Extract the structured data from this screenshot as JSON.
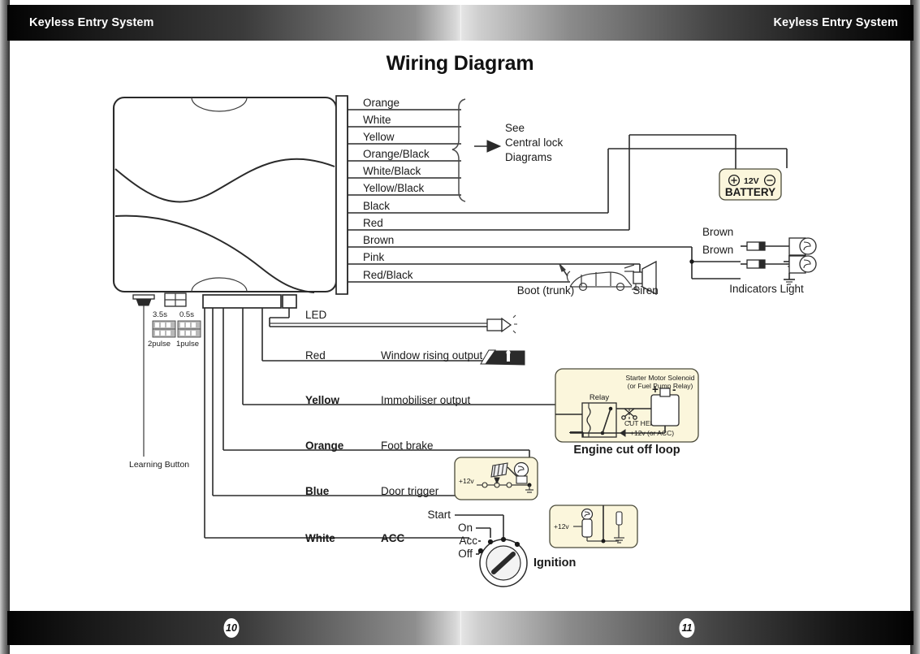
{
  "header": {
    "title_left": "Keyless Entry System",
    "title_right": "Keyless Entry System"
  },
  "footer": {
    "page_left": "10",
    "page_right": "11"
  },
  "diagram": {
    "title": "Wiring Diagram",
    "central_lock_note": [
      "See",
      "Central lock",
      "Diagrams"
    ],
    "harness_wires": [
      {
        "label": "Orange"
      },
      {
        "label": "White"
      },
      {
        "label": "Yellow"
      },
      {
        "label": "Orange/Black"
      },
      {
        "label": "White/Black"
      },
      {
        "label": "Yellow/Black"
      },
      {
        "label": "Black"
      },
      {
        "label": "Red"
      },
      {
        "label": "Brown"
      },
      {
        "label": "Pink"
      },
      {
        "label": "Red/Black"
      }
    ],
    "battery": {
      "voltage": "12V",
      "name": "BATTERY",
      "plus": "+",
      "minus": "-"
    },
    "indicators": {
      "wire_top": "Brown",
      "wire_bottom": "Brown",
      "label": "Indicators Light"
    },
    "boot_label": "Boot (trunk)",
    "siren_label": "Siren",
    "dip_switches": [
      {
        "time": "3.5s",
        "pulse": "2pulse"
      },
      {
        "time": "0.5s",
        "pulse": "1pulse"
      }
    ],
    "learning_button_label": "Learning Button",
    "outputs": [
      {
        "color": "",
        "bold": false,
        "func": "LED"
      },
      {
        "color": "Red",
        "bold": false,
        "func": "Window rising output"
      },
      {
        "color": "Yellow",
        "bold": true,
        "func": "Immobiliser output"
      },
      {
        "color": "Orange",
        "bold": true,
        "func": "Foot brake"
      },
      {
        "color": "Blue",
        "bold": true,
        "func": "Door trigger"
      },
      {
        "color": "White",
        "bold": true,
        "func": "ACC"
      }
    ],
    "engine_cutoff": {
      "title": "Engine cut off loop",
      "solenoid_line1": "Starter Motor Solenoid",
      "solenoid_line2": "(or Fuel Pump Relay)",
      "relay_label": "Relay",
      "cut_here": "CUT HERE",
      "supply_label": "+12v (or ACC)",
      "plus": "+",
      "minus": "-"
    },
    "door_trigger_box": {
      "supply_label": "+12v"
    },
    "acc_box": {
      "supply_label": "+12v"
    },
    "ignition": {
      "label": "Ignition",
      "positions": [
        "Start",
        "On",
        "Acc",
        "Off"
      ]
    }
  },
  "colors": {
    "cream": "#fbf6dc",
    "line": "#2a2a2a",
    "bar_light": "#e6e6e6",
    "bar_dark": "#020202"
  }
}
